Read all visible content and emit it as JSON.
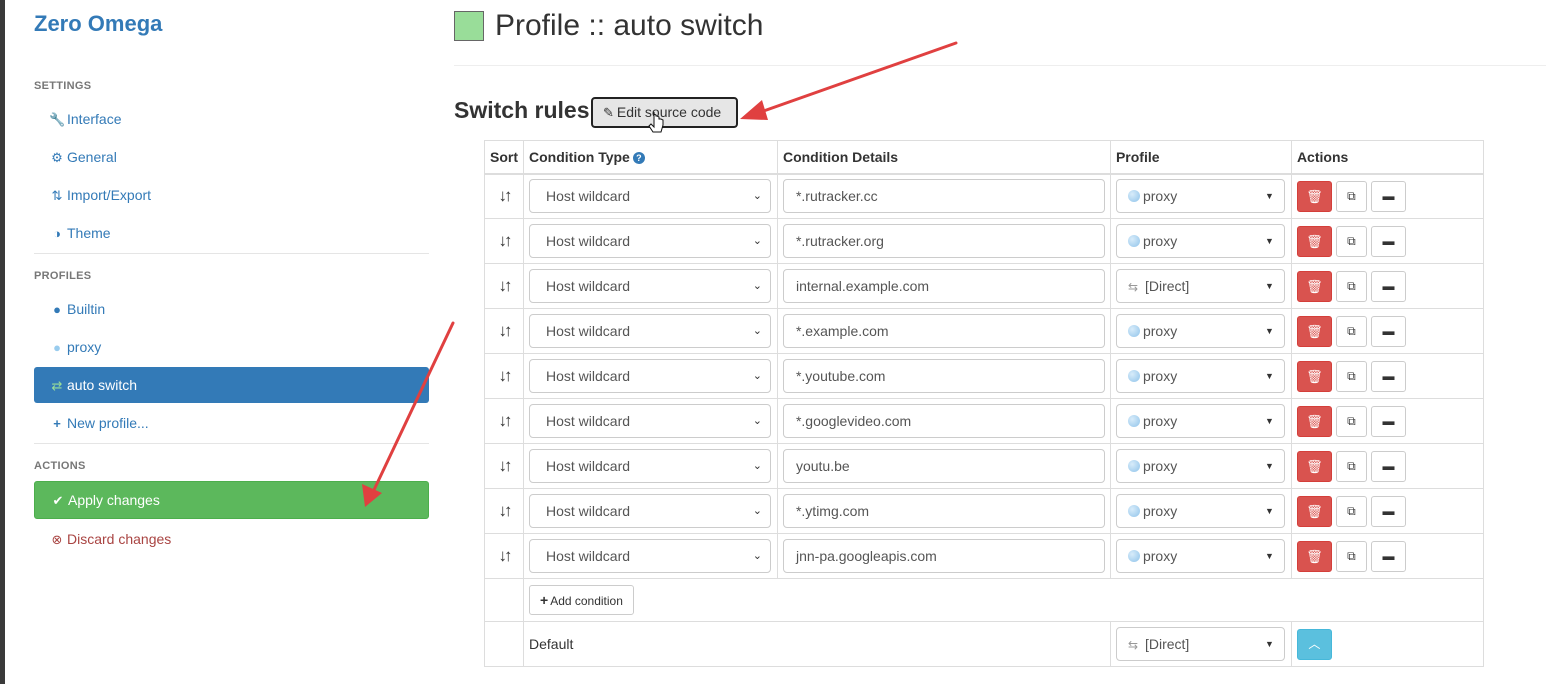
{
  "app": {
    "brand": "Zero Omega"
  },
  "sidebar": {
    "settings_header": "SETTINGS",
    "settings": [
      {
        "label": "Interface",
        "icon": "wrench-icon"
      },
      {
        "label": "General",
        "icon": "gear-icon"
      },
      {
        "label": "Import/Export",
        "icon": "import-export-icon"
      },
      {
        "label": "Theme",
        "icon": "contrast-icon"
      }
    ],
    "profiles_header": "PROFILES",
    "profiles": [
      {
        "label": "Builtin",
        "icon": "globe-icon"
      },
      {
        "label": "proxy",
        "icon": "globe-icon",
        "color": "#99ccee"
      },
      {
        "label": "auto switch",
        "icon": "retweet-icon",
        "active": true,
        "color": "#99dd99"
      },
      {
        "label": "New profile...",
        "icon": "plus-icon"
      }
    ],
    "actions_header": "ACTIONS",
    "apply_label": "Apply changes",
    "discard_label": "Discard changes"
  },
  "main": {
    "title": "Profile :: auto switch",
    "profile_color": "#99dd99",
    "section_title": "Switch rules",
    "edit_source_label": "Edit source code",
    "columns": {
      "sort": "Sort",
      "type": "Condition Type",
      "details": "Condition Details",
      "profile": "Profile",
      "actions": "Actions"
    },
    "rules": [
      {
        "type": "Host wildcard",
        "details": "*.rutracker.cc",
        "profile": "proxy"
      },
      {
        "type": "Host wildcard",
        "details": "*.rutracker.org",
        "profile": "proxy"
      },
      {
        "type": "Host wildcard",
        "details": "internal.example.com",
        "profile": "[Direct]"
      },
      {
        "type": "Host wildcard",
        "details": "*.example.com",
        "profile": "proxy"
      },
      {
        "type": "Host wildcard",
        "details": "*.youtube.com",
        "profile": "proxy"
      },
      {
        "type": "Host wildcard",
        "details": "*.googlevideo.com",
        "profile": "proxy"
      },
      {
        "type": "Host wildcard",
        "details": "youtu.be",
        "profile": "proxy"
      },
      {
        "type": "Host wildcard",
        "details": "*.ytimg.com",
        "profile": "proxy"
      },
      {
        "type": "Host wildcard",
        "details": "jnn-pa.googleapis.com",
        "profile": "proxy"
      }
    ],
    "add_condition_label": "Add condition",
    "default_label": "Default",
    "default_profile": "[Direct]"
  },
  "colors": {
    "primary": "#337ab7",
    "success": "#5cb85c",
    "danger": "#d9534f",
    "info": "#5bc0de",
    "annotation_arrow": "#e04040"
  }
}
